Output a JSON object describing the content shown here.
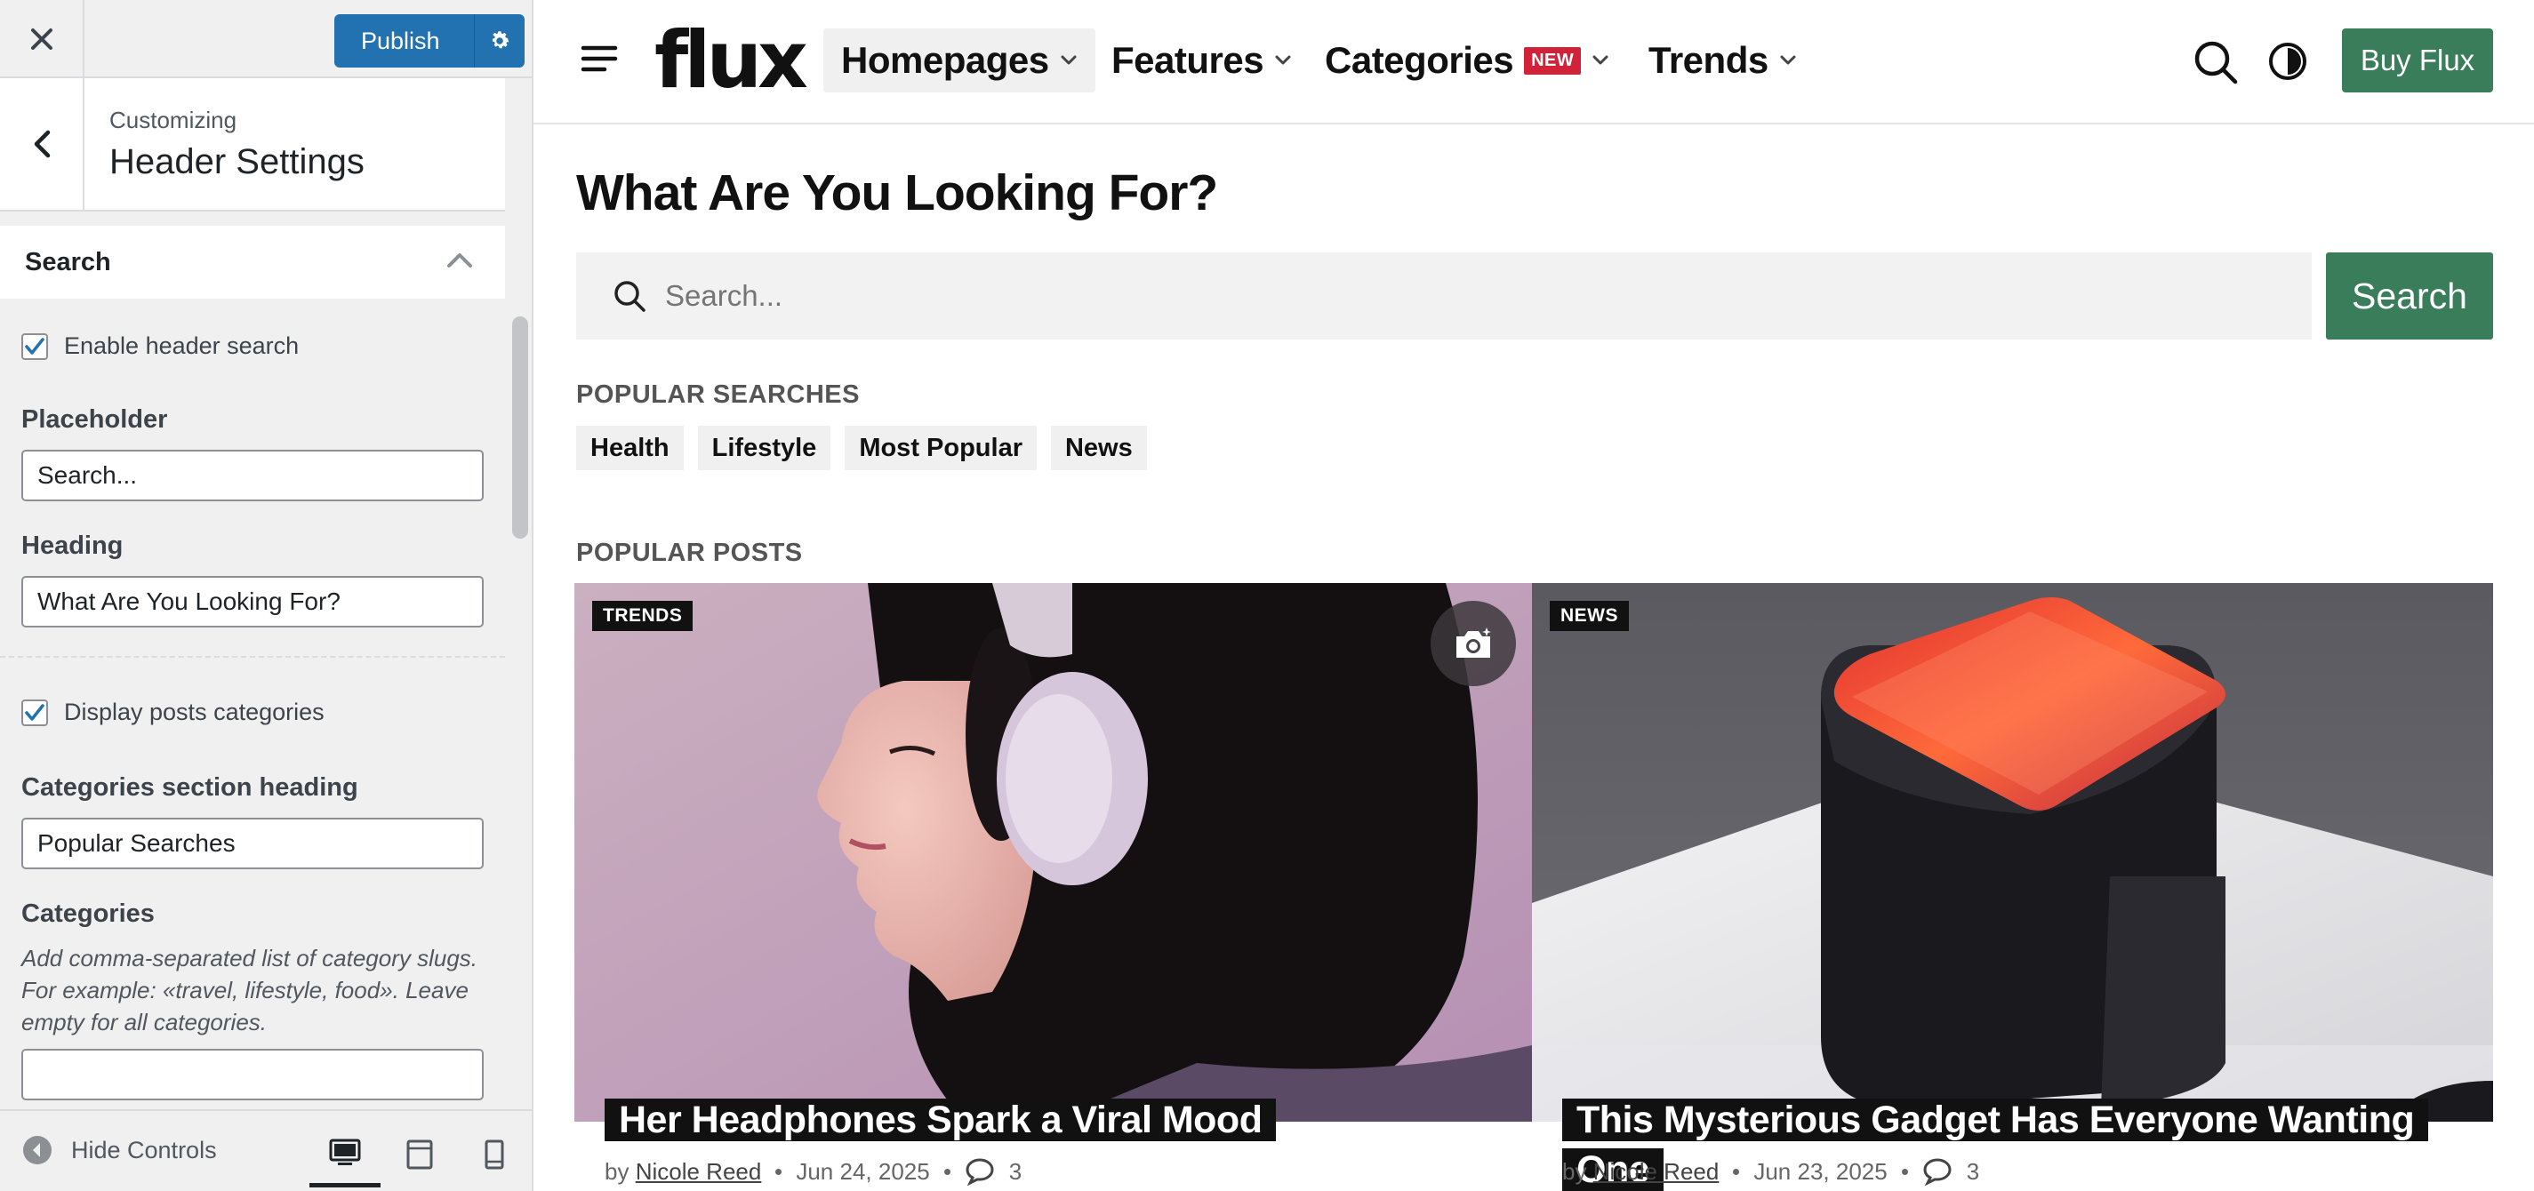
{
  "customizer": {
    "publish_label": "Publish",
    "customizing_label": "Customizing",
    "section_title": "Header Settings",
    "search_section": {
      "title": "Search",
      "enable_label": "Enable header search",
      "enable_checked": true,
      "placeholder_label": "Placeholder",
      "placeholder_value": "Search...",
      "heading_label": "Heading",
      "heading_value": "What Are You Looking For?",
      "display_categories_label": "Display posts categories",
      "display_categories_checked": true,
      "categories_heading_label": "Categories section heading",
      "categories_heading_value": "Popular Searches",
      "categories_label": "Categories",
      "categories_description": "Add comma-separated list of category slugs. For example: «travel, lifestyle, food». Leave empty for all categories.",
      "categories_value": ""
    },
    "footer": {
      "hide_controls_label": "Hide Controls",
      "devices": [
        "desktop",
        "tablet",
        "mobile"
      ],
      "active_device": "desktop"
    }
  },
  "site": {
    "logo": "flux",
    "nav": [
      {
        "label": "Homepages",
        "active": true
      },
      {
        "label": "Features"
      },
      {
        "label": "Categories",
        "badge": "NEW"
      },
      {
        "label": "Trends"
      }
    ],
    "buy_label": "Buy Flux",
    "accent_color": "#3a7d5a",
    "search": {
      "heading": "What Are You Looking For?",
      "placeholder": "Search...",
      "button_label": "Search"
    },
    "popular_searches": {
      "heading": "POPULAR SEARCHES",
      "tags": [
        "Health",
        "Lifestyle",
        "Most Popular",
        "News"
      ]
    },
    "popular_posts": {
      "heading": "POPULAR POSTS",
      "posts": [
        {
          "badge": "TRENDS",
          "title": "Her Headphones Spark a Viral Mood",
          "by": "by",
          "author": "Nicole Reed",
          "date": "Jun 24, 2025",
          "comments": "3",
          "has_gallery_icon": true
        },
        {
          "badge": "NEWS",
          "title": "This Mysterious Gadget Has Everyone Wanting One",
          "by": "by",
          "author": "Nicole Reed",
          "date": "Jun 23, 2025",
          "comments": "3"
        }
      ]
    }
  }
}
